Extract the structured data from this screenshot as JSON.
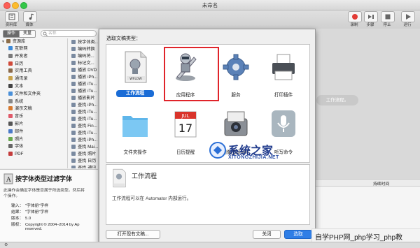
{
  "window": {
    "title": "未命名"
  },
  "toolbar": {
    "left": [
      {
        "label": "资料库"
      },
      {
        "label": "媒体"
      }
    ],
    "right": [
      {
        "label": "录制"
      },
      {
        "label": "步骤"
      },
      {
        "label": "停止"
      },
      {
        "label": "运行"
      }
    ]
  },
  "library": {
    "tabs": [
      "操作",
      "变量"
    ],
    "search_placeholder": "名称",
    "root": "资源库",
    "categories": [
      "互联网",
      "开发者",
      "日历",
      "实用工具",
      "通讯录",
      "文本",
      "文件和文件夹",
      "系统",
      "演示文稿",
      "音乐",
      "影片",
      "邮件",
      "照片",
      "字体",
      "PDF"
    ],
    "actions": [
      "按字体类...",
      "编码转换",
      "编码将...",
      "标记文...",
      "播放 DVD",
      "播放 iPh...",
      "播放 iTu...",
      "播放 iTu...",
      "播放影片",
      "查找 iPh...",
      "查找 iTu...",
      "查找 iTu...",
      "查找 Fin...",
      "查找 iTu...",
      "查找 iPh...",
      "查找 Mai...",
      "查找 照片",
      "查找 日历",
      "查找 通讯"
    ],
    "description": {
      "title": "按字体类型过滤字体",
      "text": "此操作会确定字体是否属于所选类型。然后将",
      "text2": "个操作。",
      "fields": [
        {
          "k": "输入：",
          "v": "\"字体册\"字样"
        },
        {
          "k": "结果：",
          "v": "\"字体册\"字样"
        },
        {
          "k": "版本：",
          "v": "5.0"
        },
        {
          "k": "版权：",
          "v": "Copyright © 2004–2014 by Ap"
        },
        {
          "k": "",
          "v": "reserved."
        }
      ]
    }
  },
  "workflow": {
    "placeholder": "工作流程。",
    "column_header": "持续时间"
  },
  "sheet": {
    "heading": "选取文稿类型：",
    "types": [
      {
        "label": "工作流程",
        "icon": "workflow-icon",
        "selected": true
      },
      {
        "label": "应用程序",
        "icon": "application-robot-icon",
        "highlighted": true
      },
      {
        "label": "服务",
        "icon": "gear-icon"
      },
      {
        "label": "打印插件",
        "icon": "printer-icon"
      },
      {
        "label": "文件夹操作",
        "icon": "folder-icon"
      },
      {
        "label": "日历提醒",
        "icon": "calendar-icon"
      },
      {
        "label": "图像捕捉插件",
        "icon": "image-capture-icon"
      },
      {
        "label": "听写命令",
        "icon": "microphone-icon"
      }
    ],
    "calendar": {
      "month": "JUL",
      "day": "17"
    },
    "workflow_icon_text": "WFLOW",
    "detail": {
      "title": "工作流程",
      "text": "工作流程可以在 Automator 内部运行。"
    },
    "open_button": "打开现有文稿...",
    "close_button": "关闭",
    "choose_button": "选取"
  },
  "watermarks": {
    "site_name": "系统之家",
    "site_url": "XITONGZHIJIA.NET",
    "banner": "自学PHP网_php学习_php教"
  },
  "colors": {
    "selection_blue": "#1a6cd6",
    "highlight_red": "#e0242a",
    "record_red": "#e23b36"
  }
}
